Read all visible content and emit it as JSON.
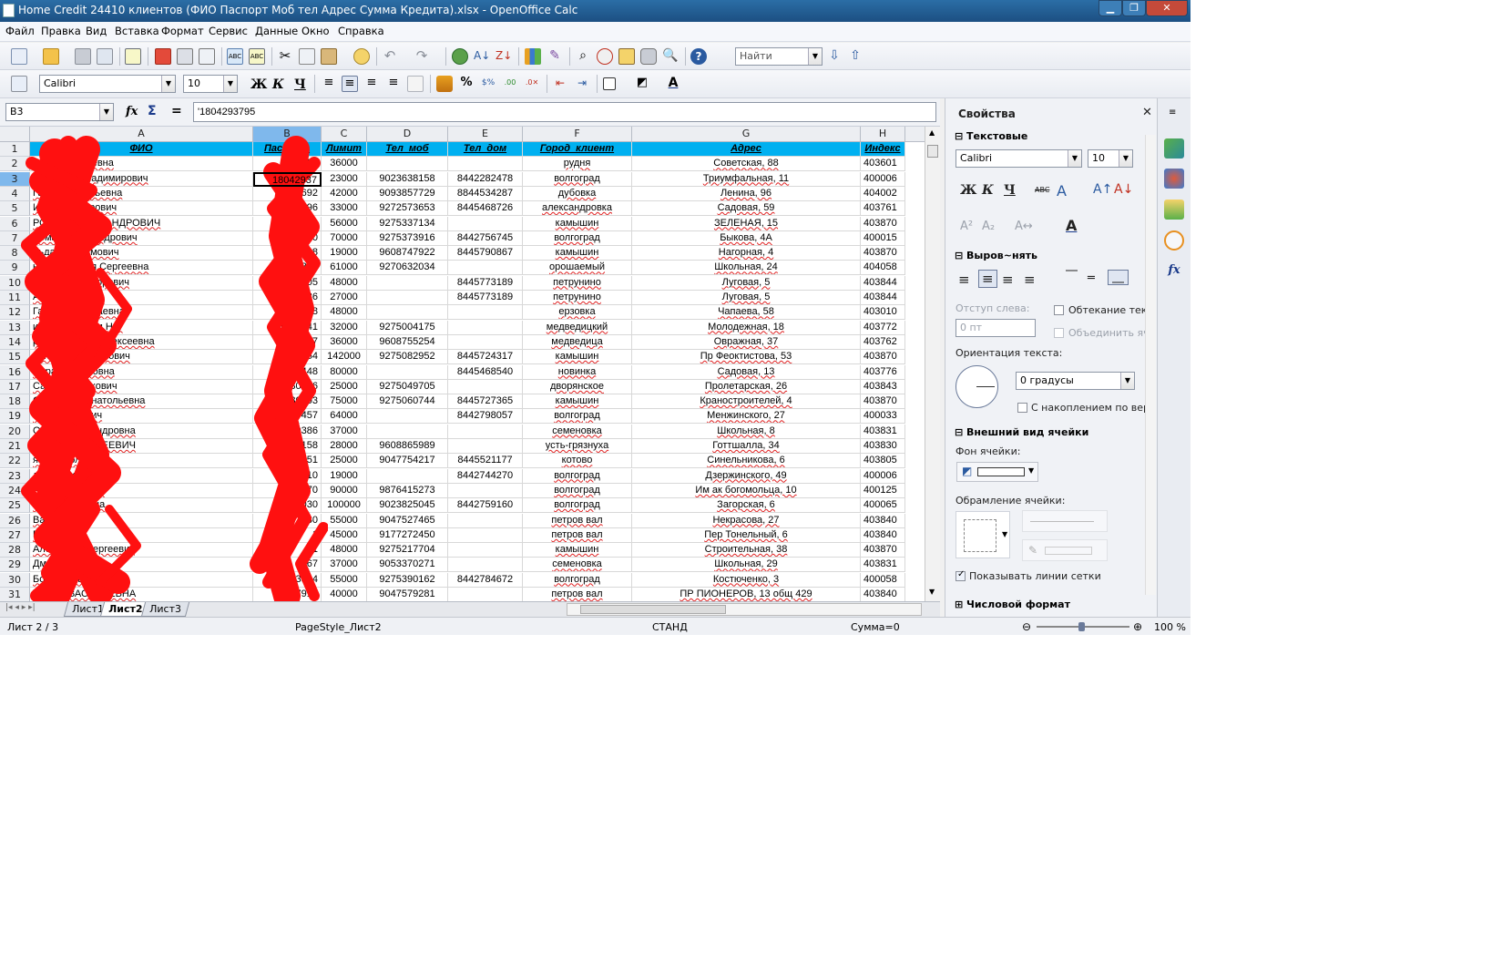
{
  "window": {
    "title": "Home Credit 24410 клиентов (ФИО Паспорт Моб тел Адрес Сумма Кредита).xlsx - OpenOffice Calc",
    "min_icon": "minimize-icon",
    "max_icon": "maximize-icon",
    "close_icon": "close-icon"
  },
  "menu": [
    "Файл",
    "Правка",
    "Вид",
    "Вставка",
    "Формат",
    "Сервис",
    "Данные",
    "Окно",
    "Справка"
  ],
  "toolbar": {
    "find_placeholder": "Найти",
    "font_name": "Calibri",
    "font_size": "10",
    "bold": "Ж",
    "italic": "К",
    "underline": "Ч"
  },
  "formula_bar": {
    "name_box": "B3",
    "fx": "fx",
    "sigma": "Σ",
    "equals": "=",
    "content": "'1804293795"
  },
  "sheet": {
    "columns": [
      "A",
      "B",
      "C",
      "D",
      "E",
      "F",
      "G",
      "H"
    ],
    "selected_column": "B",
    "selected_row": 3,
    "headers": [
      "ФИО",
      "Паспорт",
      "Лимит",
      "Тел_моб",
      "Тел_дом",
      "Город_клиент",
      "Адрес",
      "Индекс"
    ],
    "rows": [
      [
        "ина Пантелеевна",
        "18037",
        "36000",
        "",
        "",
        "рудня",
        "Советская, 88",
        "403601"
      ],
      [
        "М         ксандр Владимирович",
        "18042937",
        "23000",
        "9023638158",
        "8442282478",
        "волгоград",
        "Триумфальная, 11",
        "400006"
      ],
      [
        "Галина Евгеньевна",
        "1805692",
        "42000",
        "9093857729",
        "8844534287",
        "дубовка",
        "Ленина, 96",
        "404002"
      ],
      [
        "Игорь Викторович",
        "1804396",
        "33000",
        "9272573653",
        "8445468726",
        "александровка",
        "Садовая, 59",
        "403761"
      ],
      [
        "РОМАН АЛЕКСАНДРОВИЧ",
        "1804680",
        "56000",
        "9275337134",
        "",
        "камышин",
        "ЗЕЛЕНАЯ, 15",
        "403870"
      ],
      [
        "Роман Александрович",
        "1804200",
        "70000",
        "9275373916",
        "8442756745",
        "волгоград",
        "Быкова, 4А",
        "400015"
      ],
      [
        "льдар Рустамович",
        "9203568",
        "19000",
        "9608747922",
        "8445790867",
        "камышин",
        "Нагорная, 4",
        "403870"
      ],
      [
        "нова Наталья Сергеевна",
        "1804362",
        "61000",
        "9270632034",
        "",
        "орошаемый",
        "Школьная, 24",
        "404058"
      ],
      [
        "Николай Викторович",
        "1801405",
        "48000",
        "",
        "8445773189",
        "петрунино",
        "Луговая, 5",
        "403844"
      ],
      [
        "Анна Ивановна",
        "1803586",
        "27000",
        "",
        "8445773189",
        "петрунино",
        "Луговая, 5",
        "403844"
      ],
      [
        "Галина Николаевна",
        "1803798",
        "48000",
        "",
        "",
        "ерзовка",
        "Чапаева, 58",
        "403010"
      ],
      [
        "имов Агакерим Нет",
        "1803841",
        "32000",
        "9275004175",
        "",
        "медведицкий",
        "Молодежная, 18",
        "403772"
      ],
      [
        "рва Светлана Алексеевна",
        "180157",
        "36000",
        "9608755254",
        "",
        "медведица",
        "Овражная, 37",
        "403762"
      ],
      [
        "Олег Александрович",
        "180454",
        "142000",
        "9275082952",
        "8445724317",
        "камышин",
        "Пр Феоктистова, 53",
        "403870"
      ],
      [
        "мира Размиковна",
        "180448",
        "80000",
        "",
        "8445468540",
        "новинка",
        "Садовая, 13",
        "403776"
      ],
      [
        "Савад Рафикович",
        "180036",
        "25000",
        "9275049705",
        "",
        "дворянское",
        "Пролетарская, 26",
        "403843"
      ],
      [
        "С         Наталья Анатольевна",
        "180303",
        "75000",
        "9275060744",
        "8445727365",
        "камышин",
        "Краностроителей, 4",
        "403870"
      ],
      [
        "Владимирович",
        "180457",
        "64000",
        "",
        "8442798057",
        "волгоград",
        "Менжинского, 27",
        "400033"
      ],
      [
        "Ольга Александровна",
        "180386",
        "37000",
        "",
        "",
        "семеновка",
        "Школьная, 8",
        "403831"
      ],
      [
        "КСАНДР СЕРГЕЕВИЧ",
        "180158",
        "28000",
        "9608865989",
        "",
        "усть-грязнуха",
        "Готтшалла, 34",
        "403830"
      ],
      [
        "яна Николаевна",
        "180151",
        "25000",
        "9047754217",
        "8445521177",
        "котово",
        "Синельникова, 6",
        "403805"
      ],
      [
        "лана Викторовна",
        "180010",
        "19000",
        "",
        "8442744270",
        "волгоград",
        "Дзержинского, 49",
        "400006"
      ],
      [
        "Александрович",
        "18070",
        "90000",
        "9876415273",
        "",
        "волгоград",
        "Им ак богомольца, 10",
        "400125"
      ],
      [
        "Александровна",
        "18030",
        "100000",
        "9023825045",
        "8442759160",
        "волгоград",
        "Загорская, 6",
        "400065"
      ],
      [
        "Васильевич",
        "180",
        "55000",
        "9047527465",
        "",
        "петров вал",
        "Некрасова, 27",
        "403840"
      ],
      [
        "Петрович",
        "1",
        "45000",
        "9177272450",
        "",
        "петров вал",
        "Пер Тонельный, 6",
        "403840"
      ],
      [
        "Александр Сергеевич",
        "1",
        "48000",
        "9275217704",
        "",
        "камышин",
        "Строительная, 38",
        "403870"
      ],
      [
        "Дмитриевна",
        "8067",
        "37000",
        "9053370271",
        "",
        "семеновка",
        "Школьная, 29",
        "403831"
      ],
      [
        "Борисовна",
        "3304",
        "55000",
        "9275390162",
        "8442784672",
        "волгоград",
        "Костюченко, 3",
        "400058"
      ],
      [
        "ТАЛЬЯ ВАСИЛЬЕВНА",
        "7919",
        "40000",
        "9047579281",
        "",
        "петров вал",
        "ПР ПИОНЕРОВ, 13 общ 429",
        "403840"
      ]
    ]
  },
  "tabs": [
    "Лист1",
    "Лист2",
    "Лист3"
  ],
  "active_tab": "Лист2",
  "status": {
    "sheet": "Лист 2 / 3",
    "page_style": "PageStyle_Лист2",
    "mode": "СТАНД",
    "sum": "Сумма=0",
    "zoom": "100 %"
  },
  "sidebar": {
    "title": "Свойства",
    "text_section": "Текстовые",
    "font_name": "Calibri",
    "font_size": "10",
    "align_section": "Выров~нять",
    "indent_label": "Отступ слева:",
    "indent_value": "0 пт",
    "wrap_label": "Обтекание тек",
    "merge_label": "Объединить яч",
    "orientation_label": "Ориентация текста:",
    "orientation_value": "0 градусы",
    "stack_label": "С накоплением по вер",
    "appearance_section": "Внешний вид ячейки",
    "bg_label": "Фон ячейки:",
    "border_label": "Обрамление ячейки:",
    "gridlines_label": "Показывать линии сетки",
    "number_section": "Числовой формат"
  },
  "colors": {
    "header_fill": "#00b0f0",
    "selection": "#7fb8ec",
    "scribble": "#ff0000"
  }
}
